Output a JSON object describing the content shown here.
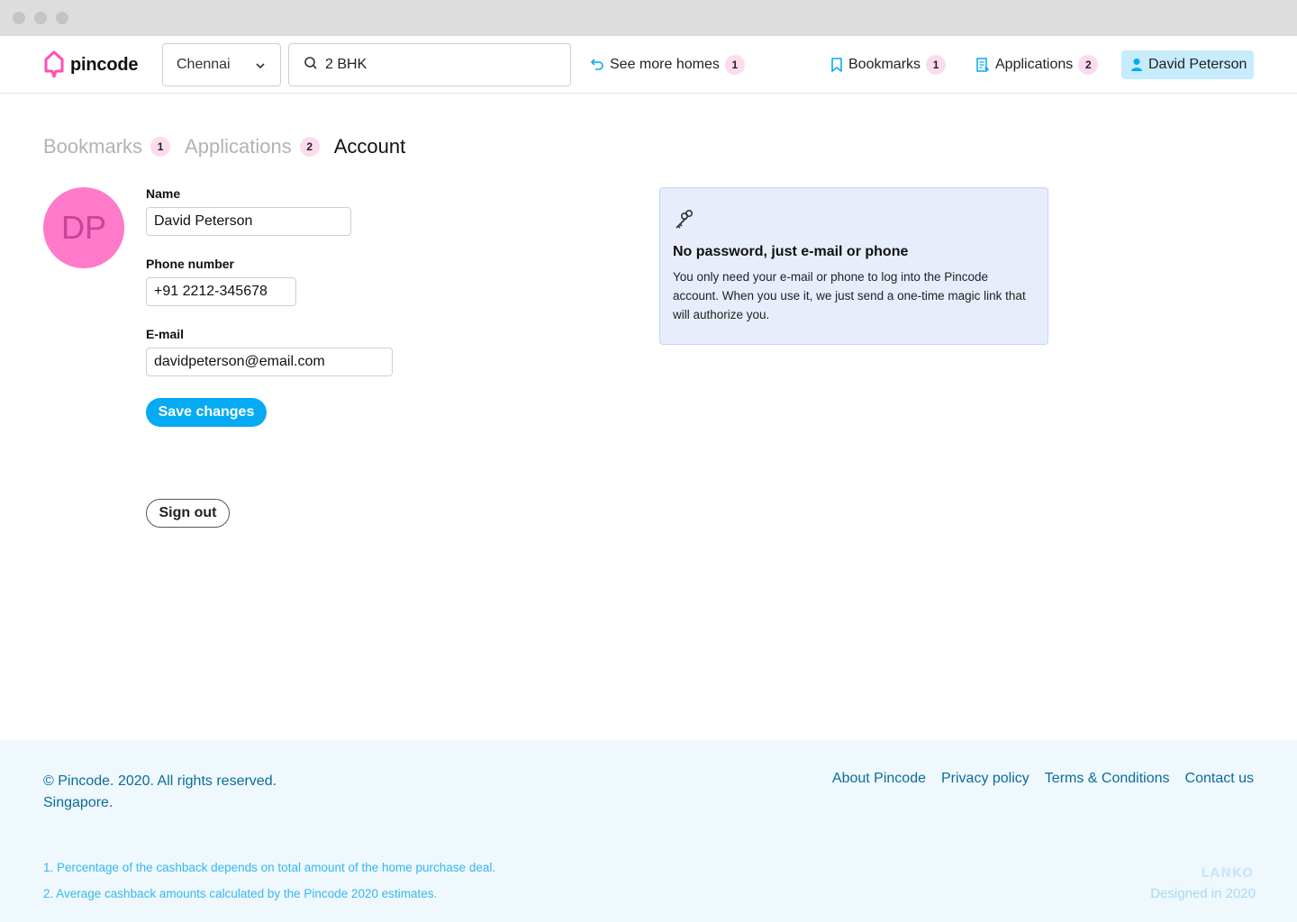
{
  "header": {
    "brand": "pincode",
    "city": "Chennai",
    "search_value": "2 BHK",
    "see_more": {
      "label": "See more homes",
      "count": "1"
    },
    "bookmarks": {
      "label": "Bookmarks",
      "count": "1"
    },
    "applications": {
      "label": "Applications",
      "count": "2"
    },
    "user": "David Peterson"
  },
  "tabs": [
    {
      "label": "Bookmarks",
      "count": "1"
    },
    {
      "label": "Applications",
      "count": "2"
    },
    {
      "label": "Account"
    }
  ],
  "account": {
    "initials": "DP",
    "name_label": "Name",
    "name_value": "David Peterson",
    "phone_label": "Phone number",
    "phone_value": "+91 2212-345678",
    "email_label": "E-mail",
    "email_value": "davidpeterson@email.com",
    "save_label": "Save changes",
    "signout_label": "Sign out"
  },
  "info": {
    "icon": "keys-icon",
    "title": "No password, just e-mail or phone",
    "text": "You only need your e-mail or phone to log into the Pincode account. When you use it, we just send a one-time magic link that will authorize you."
  },
  "footer": {
    "copyright_line1": "© Pincode. 2020. All rights reserved.",
    "copyright_line2": "Singapore.",
    "links": [
      "About Pincode",
      "Privacy policy",
      "Terms & Conditions",
      "Contact us"
    ],
    "notes": [
      "1. Percentage of the cashback depends on total amount of the home purchase deal.",
      "2. Average cashback amounts calculated by the Pincode 2020 estimates."
    ],
    "credit_brand": "LANKO",
    "credit_text": "Designed in 2020"
  },
  "colors": {
    "accent": "#06aaf2",
    "brand_pink": "#ff7ac8",
    "badge_bg": "#fcdbee",
    "footer_bg": "#eff8fd",
    "info_bg": "#e8edfc"
  }
}
